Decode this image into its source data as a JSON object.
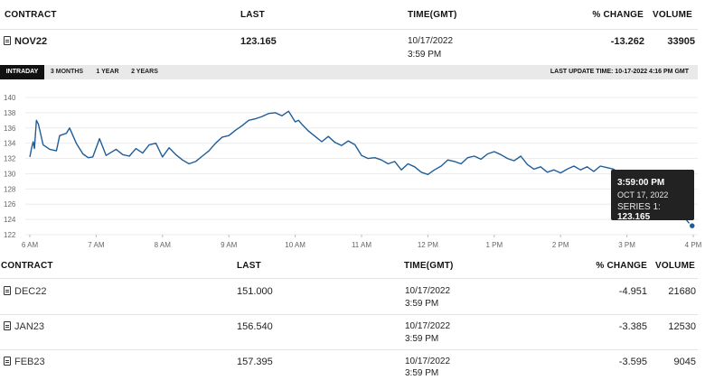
{
  "top_table": {
    "headers": {
      "contract": "CONTRACT",
      "last": "LAST",
      "time": "TIME(GMT)",
      "change": "% CHANGE",
      "volume": "VOLUME"
    },
    "row": {
      "contract": "NOV22",
      "last": "123.165",
      "date": "10/17/2022",
      "time": "3:59 PM",
      "change": "-13.262",
      "volume": "33905"
    }
  },
  "tabs": [
    "INTRADAY",
    "3 MONTHS",
    "1 YEAR",
    "2 YEARS"
  ],
  "active_tab": "INTRADAY",
  "last_update": "LAST UPDATE TIME: 10-17-2022 4:16 PM GMT",
  "chart_data": {
    "type": "line",
    "y_ticks": [
      "140",
      "138",
      "136",
      "134",
      "132",
      "130",
      "128",
      "126",
      "124",
      "122"
    ],
    "x_ticks": [
      "6 AM",
      "7 AM",
      "8 AM",
      "9 AM",
      "10 AM",
      "11 AM",
      "12 PM",
      "1 PM",
      "2 PM",
      "3 PM",
      "4 PM"
    ],
    "ylim": [
      122,
      140
    ],
    "grid": true,
    "line_color": "#1f5d99",
    "series": [
      {
        "x": [
          6.0,
          6.03,
          6.05,
          6.07,
          6.1,
          6.13,
          6.2,
          6.3,
          6.4,
          6.45,
          6.55,
          6.6,
          6.7,
          6.8,
          6.88,
          6.95,
          7.05,
          7.15,
          7.3,
          7.4,
          7.5,
          7.6,
          7.7,
          7.8,
          7.9,
          8.0,
          8.1,
          8.2,
          8.3,
          8.4,
          8.5,
          8.6,
          8.7,
          8.8,
          8.9,
          9.0,
          9.1,
          9.2,
          9.3,
          9.4,
          9.5,
          9.6,
          9.7,
          9.8,
          9.9,
          10.0,
          10.05,
          10.1,
          10.2,
          10.3,
          10.4,
          10.5,
          10.6,
          10.7,
          10.8,
          10.9,
          11.0,
          11.1,
          11.2,
          11.3,
          11.4,
          11.5,
          11.6,
          11.7,
          11.8,
          11.9,
          12.0,
          12.1,
          12.2,
          12.3,
          12.4,
          12.5,
          12.6,
          12.7,
          12.8,
          12.9,
          13.0,
          13.1,
          13.2,
          13.3,
          13.4,
          13.5,
          13.6,
          13.7,
          13.8,
          13.9,
          14.0,
          14.1,
          14.2,
          14.3,
          14.4,
          14.5,
          14.6,
          14.7,
          14.8,
          14.9,
          15.0,
          15.1,
          15.2,
          15.3,
          15.4,
          15.5,
          15.6,
          15.65,
          15.7,
          15.75,
          15.8,
          15.85,
          15.9,
          15.95,
          15.983
        ],
        "y": [
          132.2,
          133.5,
          134.2,
          133.3,
          137.0,
          136.5,
          133.8,
          133.2,
          133.0,
          135.0,
          135.3,
          136.0,
          134.0,
          132.6,
          132.1,
          132.2,
          134.6,
          132.4,
          133.2,
          132.5,
          132.3,
          133.3,
          132.7,
          133.8,
          134.0,
          132.2,
          133.4,
          132.5,
          131.8,
          131.3,
          131.6,
          132.3,
          133.0,
          134.0,
          134.8,
          135.0,
          135.7,
          136.3,
          137.0,
          137.2,
          137.5,
          137.9,
          138.0,
          137.6,
          138.2,
          136.8,
          137.0,
          136.5,
          135.6,
          134.9,
          134.2,
          134.9,
          134.1,
          133.7,
          134.3,
          133.8,
          132.4,
          132.0,
          132.1,
          131.8,
          131.3,
          131.6,
          130.5,
          131.3,
          130.9,
          130.2,
          129.9,
          130.5,
          131.0,
          131.8,
          131.6,
          131.3,
          132.1,
          132.3,
          131.9,
          132.6,
          132.9,
          132.5,
          132.0,
          131.7,
          132.3,
          131.2,
          130.6,
          130.9,
          130.2,
          130.5,
          130.1,
          130.6,
          131.0,
          130.5,
          130.9,
          130.3,
          131.0,
          130.8,
          130.6,
          130.0,
          130.4,
          129.6,
          129.2,
          128.4,
          127.9,
          127.3,
          126.8,
          126.0,
          125.5,
          124.7,
          124.2,
          124.5,
          123.9,
          123.4,
          123.165
        ]
      }
    ],
    "tooltip": {
      "time": "3:59:00 PM",
      "date": "OCT 17, 2022",
      "label": "SERIES 1:",
      "value": "123.165"
    }
  },
  "bottom_table": {
    "headers": {
      "contract": "CONTRACT",
      "last": "LAST",
      "time": "TIME(GMT)",
      "change": "% CHANGE",
      "volume": "VOLUME"
    },
    "rows": [
      {
        "contract": "DEC22",
        "last": "151.000",
        "date": "10/17/2022",
        "time": "3:59 PM",
        "change": "-4.951",
        "volume": "21680"
      },
      {
        "contract": "JAN23",
        "last": "156.540",
        "date": "10/17/2022",
        "time": "3:59 PM",
        "change": "-3.385",
        "volume": "12530"
      },
      {
        "contract": "FEB23",
        "last": "157.395",
        "date": "10/17/2022",
        "time": "3:59 PM",
        "change": "-3.595",
        "volume": "9045"
      }
    ]
  }
}
